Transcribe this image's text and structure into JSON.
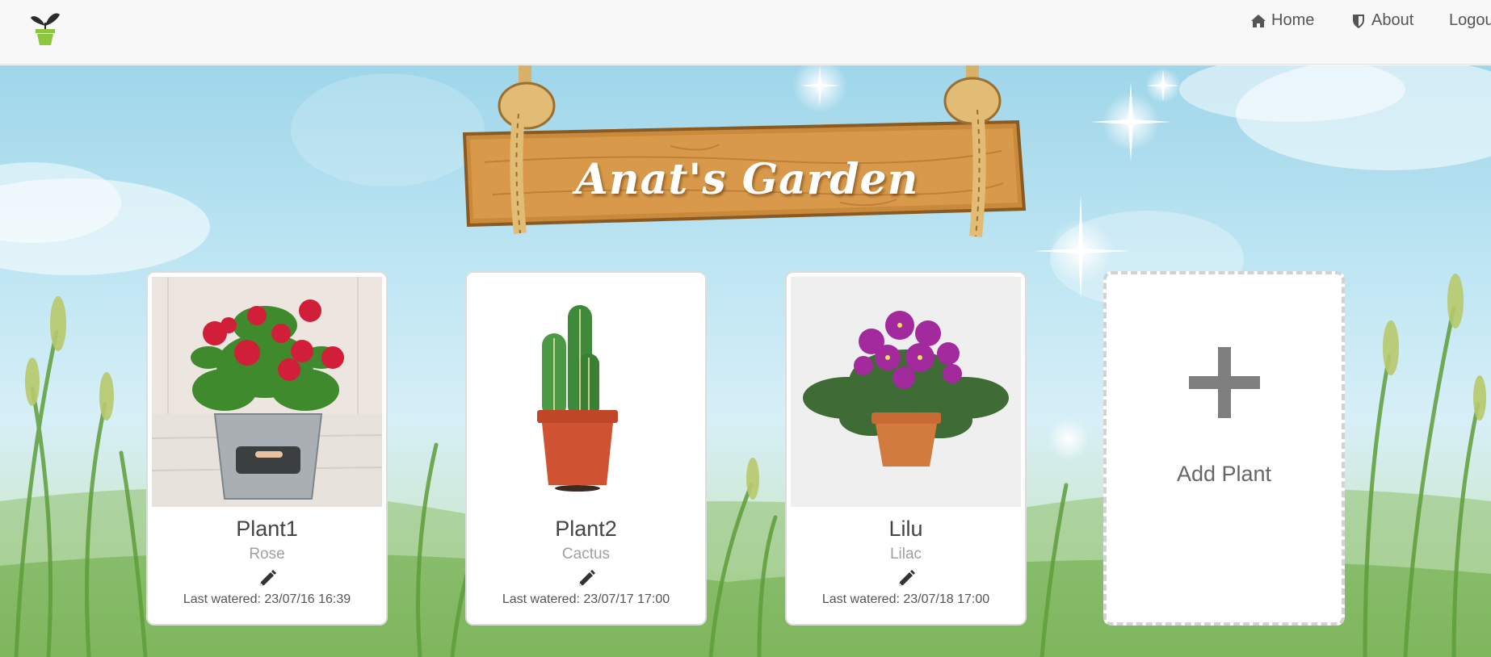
{
  "nav": {
    "home_label": "Home",
    "about_label": "About",
    "logout_label": "Logou"
  },
  "header": {
    "title": "Anat's Garden"
  },
  "plants": [
    {
      "name": "Plant1",
      "type": "Rose",
      "last_watered": "Last watered: 23/07/16 16:39"
    },
    {
      "name": "Plant2",
      "type": "Cactus",
      "last_watered": "Last watered: 23/07/17 17:00"
    },
    {
      "name": "Lilu",
      "type": "Lilac",
      "last_watered": "Last watered: 23/07/18 17:00"
    }
  ],
  "add_card": {
    "label": "Add Plant"
  },
  "icons": {
    "brand": "plant-pot-icon",
    "home": "home-icon",
    "about": "shield-icon",
    "edit": "pencil-icon",
    "add": "plus-icon"
  },
  "colors": {
    "navbar_bg": "#f8f8f8",
    "card_bg": "#ffffff",
    "sky": "#bfe6f3",
    "wood": "#c98a3c",
    "text_dark": "#444444",
    "text_muted": "#a0a0a0"
  }
}
